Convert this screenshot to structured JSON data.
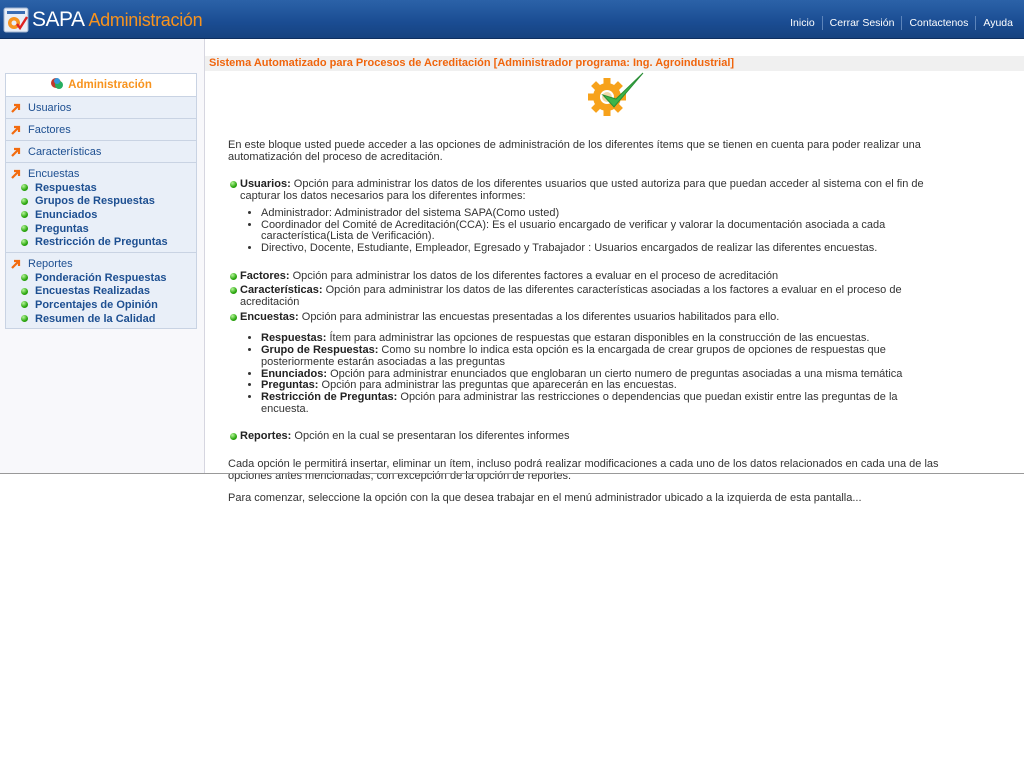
{
  "header": {
    "logo_text": "SAPA",
    "logo_subtitle": "Administración",
    "nav": [
      "Inicio",
      "Cerrar Sesión",
      "Contactenos",
      "Ayuda"
    ]
  },
  "sidebar": {
    "title": "Administración",
    "sections": [
      {
        "label": "Usuarios",
        "items": []
      },
      {
        "label": "Factores",
        "items": []
      },
      {
        "label": "Características",
        "items": []
      },
      {
        "label": "Encuestas",
        "items": [
          "Respuestas",
          "Grupos de Respuestas",
          "Enunciados",
          "Preguntas",
          "Restricción de Preguntas"
        ]
      },
      {
        "label": "Reportes",
        "items": [
          "Ponderación Respuestas",
          "Encuestas Realizadas",
          "Porcentajes de Opinión",
          "Resumen de la Calidad"
        ]
      }
    ]
  },
  "main": {
    "title": "Sistema Automatizado para Procesos de Acreditación [Administrador programa: Ing. Agroindustrial]",
    "intro": "En este bloque usted puede acceder a las opciones de administración de los diferentes ítems que se tienen en cuenta para poder realizar una automatización del proceso de acreditación.",
    "usuarios": {
      "label": "Usuarios:",
      "text": " Opción para administrar los datos de los diferentes usuarios que usted autoriza para que puedan acceder al sistema con el fin de capturar los datos necesarios para los diferentes informes:",
      "list": [
        "Administrador: Administrador del sistema SAPA(Como usted)",
        "Coordinador del Comité de Acreditación(CCA): Es el usuario encargado de verificar y valorar la documentación asociada a cada característica(Lista de Verificación).",
        "Directivo, Docente, Estudiante, Empleador, Egresado y Trabajador : Usuarios encargados de realizar las diferentes encuestas."
      ]
    },
    "factores": {
      "label": "Factores:",
      "text": " Opción para administrar los datos de los diferentes factores a evaluar en el proceso de acreditación"
    },
    "caracteristicas": {
      "label": "Características:",
      "text": " Opción para administrar los datos de las diferentes características asociadas a los factores a evaluar en el proceso de acreditación"
    },
    "encuestas": {
      "label": "Encuestas:",
      "text": " Opción para administrar las encuestas presentadas a los diferentes usuarios habilitados para ello.",
      "list": [
        {
          "label": "Respuestas:",
          "text": " Ítem para administrar las opciones de respuestas que estaran disponibles en la construcción de las encuestas."
        },
        {
          "label": "Grupo de Respuestas:",
          "text": " Como su nombre lo indica esta opción es la encargada de crear grupos de opciones de respuestas que posteriormente estarán asociadas a las preguntas"
        },
        {
          "label": "Enunciados:",
          "text": " Opción para administrar enunciados que englobaran un cierto numero de preguntas asociadas a una misma temática"
        },
        {
          "label": "Preguntas:",
          "text": " Opción para administrar las preguntas que aparecerán en las encuestas."
        },
        {
          "label": "Restricción de Preguntas:",
          "text": " Opción para administrar las restricciones o dependencias que puedan existir entre las preguntas de la encuesta."
        }
      ]
    },
    "reportes": {
      "label": "Reportes:",
      "text": " Opción en la cual se presentaran los diferentes informes"
    },
    "note1": "Cada opción le permitirá insertar, eliminar un ítem, incluso podrá realizar modificaciones a cada uno de los datos relacionados en cada una de las opciones antes mencionadas, con excepción de la opción de reportes.",
    "note2": "Para comenzar, seleccione la opción con la que desea trabajar en el menú administrador ubicado a la izquierda de esta pantalla..."
  },
  "colors": {
    "header_blue": "#1a4c92",
    "accent_orange": "#f7931e",
    "title_orange": "#f0650d",
    "link_blue": "#1d4f91"
  }
}
